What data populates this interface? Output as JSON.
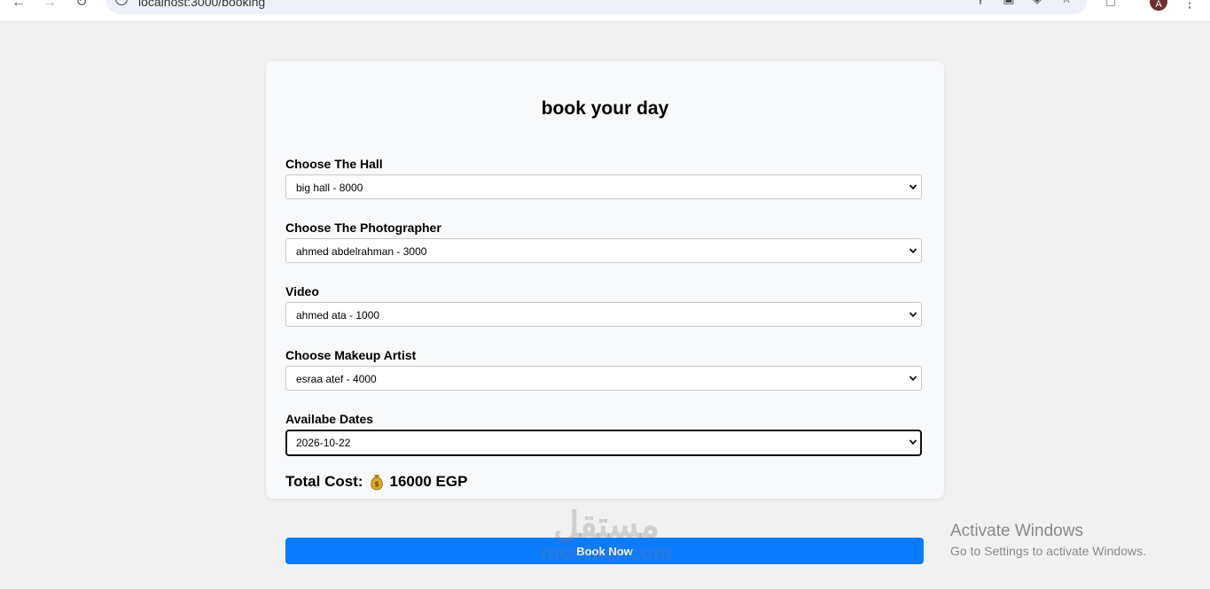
{
  "browser": {
    "url": "localhost:3000/booking",
    "avatar_letter": "A"
  },
  "card": {
    "title": "book your day",
    "fields": [
      {
        "label": "Choose The Hall",
        "value": "big hall - 8000"
      },
      {
        "label": "Choose The Photographer",
        "value": "ahmed abdelrahman - 3000"
      },
      {
        "label": "Video",
        "value": "ahmed ata - 1000"
      },
      {
        "label": "Choose Makeup Artist",
        "value": "esraa atef - 4000"
      },
      {
        "label": "Availabe Dates",
        "value": "2026-10-22"
      }
    ],
    "total_label": "Total Cost:",
    "total_value": "16000 EGP"
  },
  "book_button": "Book Now",
  "watermark": {
    "arabic": "مستقل",
    "latin": "mostaql.com"
  },
  "activate_windows": {
    "title": "Activate Windows",
    "subtitle": "Go to Settings to activate Windows."
  },
  "colors": {
    "accent": "#0a7bff",
    "page_bg": "#f1f1f1",
    "card_bg": "#f8f9fa"
  }
}
